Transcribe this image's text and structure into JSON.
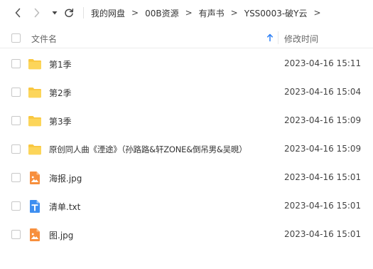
{
  "breadcrumb": {
    "items": [
      "我的网盘",
      "00B资源",
      "有声书",
      "YSS0003-破Y云"
    ],
    "separator": ">"
  },
  "header": {
    "name_col": "文件名",
    "time_col": "修改时间"
  },
  "files": [
    {
      "name": "第1季",
      "time": "2023-04-16 15:11",
      "icon": "folder-icon"
    },
    {
      "name": "第2季",
      "time": "2023-04-16 15:04",
      "icon": "folder-icon"
    },
    {
      "name": "第3季",
      "time": "2023-04-16 15:09",
      "icon": "folder-icon"
    },
    {
      "name": "原创同人曲《湮途》（孙路路&轩ZONE&倒吊男&吴晛）",
      "time": "2023-04-16 15:09",
      "icon": "folder-icon"
    },
    {
      "name": "海报.jpg",
      "time": "2023-04-16 15:01",
      "icon": "image-file-icon"
    },
    {
      "name": "清单.txt",
      "time": "2023-04-16 15:01",
      "icon": "text-file-icon"
    },
    {
      "name": "图.jpg",
      "time": "2023-04-16 15:01",
      "icon": "image-file-icon"
    }
  ],
  "colors": {
    "folder": "#f9c740",
    "image_file": "#f78f3d",
    "text_file": "#3d8ef0",
    "sort_arrow": "#2a7ef5"
  }
}
